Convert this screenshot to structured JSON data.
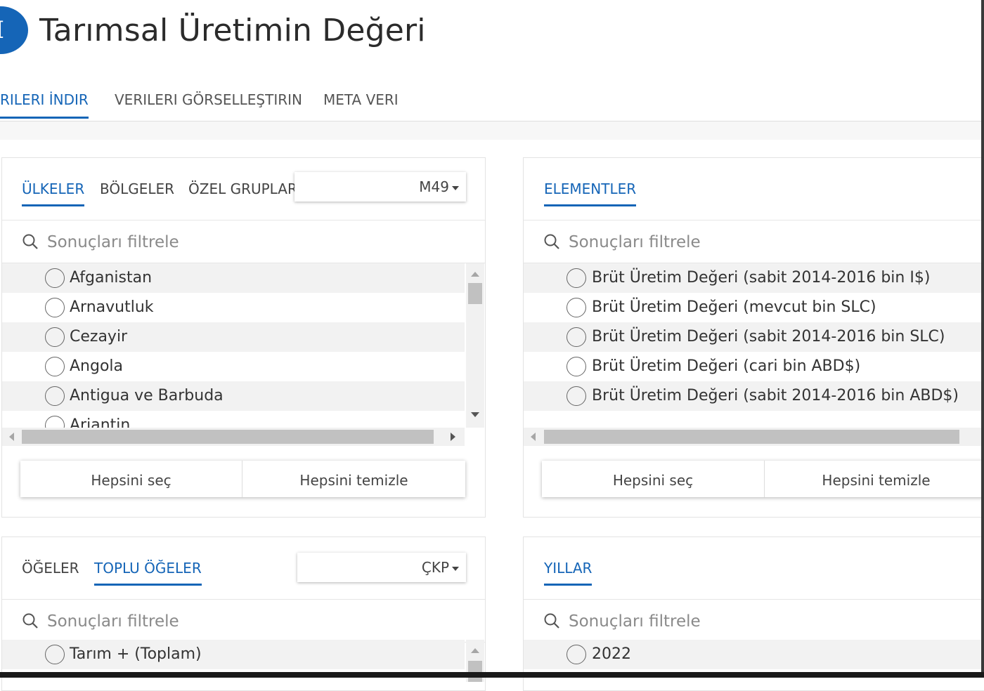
{
  "header": {
    "title": "Tarımsal Üretimin Değeri",
    "logo_letter": "I"
  },
  "tabs": [
    {
      "label": "RILERI İNDIR",
      "active": true
    },
    {
      "label": "VERILERI GÖRSELLEŞTIRIN",
      "active": false
    },
    {
      "label": "META VERI",
      "active": false
    }
  ],
  "countries_panel": {
    "tabs": [
      {
        "label": "ÜLKELER",
        "active": true
      },
      {
        "label": "BÖLGELER",
        "active": false
      },
      {
        "label": "ÖZEL GRUPLAR",
        "active": false
      }
    ],
    "dropdown": "M49",
    "filter_placeholder": "Sonuçları filtrele",
    "items": [
      "Afganistan",
      "Arnavutluk",
      "Cezayir",
      "Angola",
      "Antigua ve Barbuda",
      "Arjantin"
    ],
    "select_all": "Hepsini seç",
    "clear_all": "Hepsini temizle"
  },
  "elements_panel": {
    "tabs": [
      {
        "label": "ELEMENTLER",
        "active": true
      }
    ],
    "filter_placeholder": "Sonuçları filtrele",
    "items": [
      "Brüt Üretim Değeri (sabit 2014-2016 bin I$)",
      "Brüt Üretim Değeri (mevcut bin SLC)",
      "Brüt Üretim Değeri (sabit 2014-2016 bin SLC)",
      "Brüt Üretim Değeri (cari bin ABD$)",
      "Brüt Üretim Değeri (sabit 2014-2016 bin ABD$)"
    ],
    "select_all": "Hepsini seç",
    "clear_all": "Hepsini temizle"
  },
  "items_panel": {
    "tabs": [
      {
        "label": "ÖĞELER",
        "active": false
      },
      {
        "label": "TOPLU ÖĞELER",
        "active": true
      }
    ],
    "dropdown": "ÇKP",
    "filter_placeholder": "Sonuçları filtrele",
    "items": [
      "Tarım + (Toplam)"
    ]
  },
  "years_panel": {
    "tabs": [
      {
        "label": "YILLAR",
        "active": true
      }
    ],
    "filter_placeholder": "Sonuçları filtrele",
    "items": [
      "2022"
    ]
  },
  "icons": {
    "search": "search-icon",
    "radio": "radio-button-icon",
    "dropdown_caret": "caret-down-icon"
  },
  "colors": {
    "accent": "#1565b7",
    "text": "#333333",
    "row_alt": "#f2f2f2",
    "scroll_thumb": "#c1c1c1"
  }
}
